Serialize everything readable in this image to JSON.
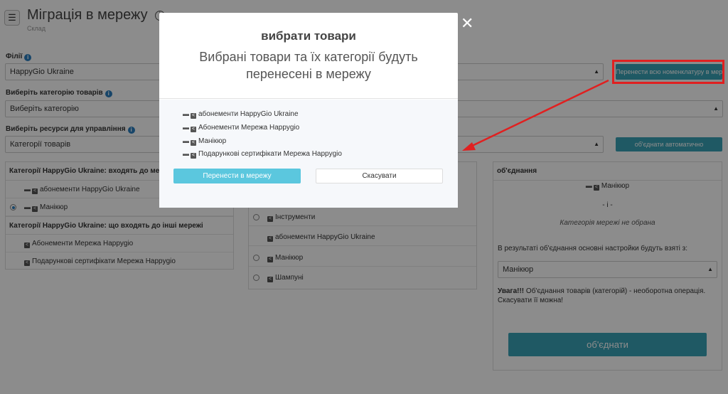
{
  "header": {
    "menu_icon": "☰",
    "title": "Міграція в мережу",
    "info_icon": "i",
    "breadcrumb": "Склад"
  },
  "filters": {
    "branch_label": "Філії",
    "branch_value": "HappyGio Ukraine",
    "category_label": "Виберіть категорію товарів",
    "category_value": "Виберіть категорію",
    "resources_label": "Виберіть ресурси для управління",
    "resources_value": "Категорії товарів",
    "transfer_all_button": "Перенести всю номенклатуру в мережу",
    "merge_auto_button": "об'єднати автоматично"
  },
  "left_panel": {
    "head_included": "Категорії HappyGio Ukraine: входять до мережі",
    "included_items": [
      "абонементи HappyGio Ukraine",
      "Манікюр"
    ],
    "selected_index": 1,
    "head_other": "Категорії HappyGio Ukraine: що входять до інші мережі",
    "other_items": [
      "Абонементи Мережа Happygio",
      "Подарункові сертифікати Мережа Happygio"
    ]
  },
  "middle_panel": {
    "items": [
      "Інструменти",
      "абонементи HappyGio Ukraine",
      "Манікюр",
      "Шампуні"
    ]
  },
  "right_panel": {
    "head": "об'єднання",
    "merge_item": "Манікюр",
    "separator": "- і -",
    "not_selected": "Категорія мережі не обрана",
    "result_text": "В результаті об'єднання основні настройки будуть взяті з:",
    "result_select": "Манікюр",
    "warning_bold": "Увага!!!",
    "warning_text": " Об'єднання товарів (категорій) - необоротна операція. Скасувати її можна!",
    "merge_button": "об'єднати"
  },
  "modal": {
    "close_icon": "✕",
    "title": "вибрати товари",
    "subtitle": "Вибрані товари та їх категорії будуть перенесені в мережу",
    "items": [
      "абонементи HappyGio Ukraine",
      "Абонементи Мережа Happygio",
      "Манікюр",
      "Подарункові сертифікати Мережа Happygio"
    ],
    "confirm_button": "Перенести в мережу",
    "cancel_button": "Скасувати"
  },
  "colors": {
    "teal": "#3aa3b6",
    "primary": "#5bc7de",
    "highlight": "#e02020"
  }
}
